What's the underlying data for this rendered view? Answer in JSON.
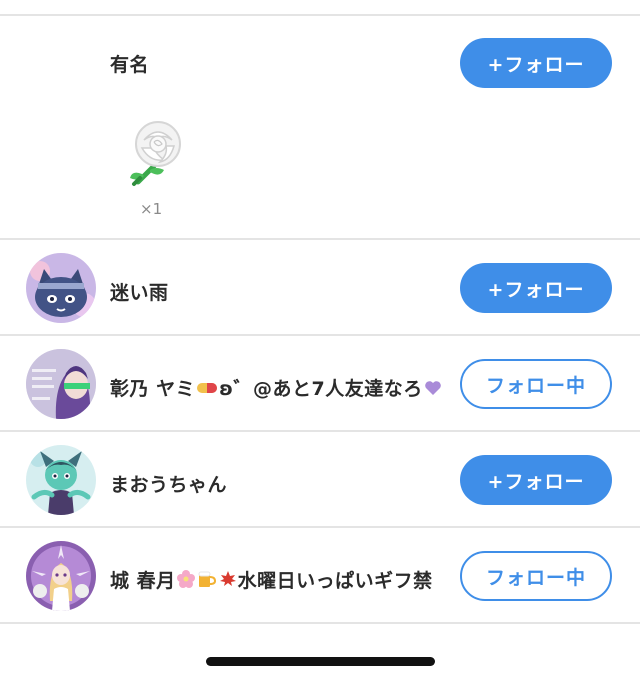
{
  "rows": [
    {
      "name": "有名",
      "button": "+フォロー",
      "state": "follow",
      "gift": {
        "icon": "white-rose-icon",
        "count": "×1"
      }
    },
    {
      "name": "迷い雨",
      "button": "+フォロー",
      "state": "follow",
      "avatar_icon": "cat-character-avatar"
    },
    {
      "name_parts": [
        "彰乃 ヤミ",
        "ʚ゛@あと7人友達なろ"
      ],
      "name_icons": [
        "pill-icon",
        "purple-heart-icon"
      ],
      "button": "フォロー中",
      "state": "following",
      "avatar_icon": "purple-hair-character-avatar"
    },
    {
      "name": "まおうちゃん",
      "button": "+フォロー",
      "state": "follow",
      "avatar_icon": "green-demon-character-avatar"
    },
    {
      "name_parts": [
        "城 春月",
        "水曜日いっぱいギフ禁"
      ],
      "name_icons": [
        "cherry-blossom-icon",
        "beer-icon",
        "maple-leaf-icon"
      ],
      "button": "フォロー中",
      "state": "following",
      "avatar_icon": "blonde-girl-character-avatar"
    }
  ],
  "colors": {
    "accent": "#3f8ee8",
    "divider": "#e4e4e4",
    "text": "#2b2b2b"
  }
}
